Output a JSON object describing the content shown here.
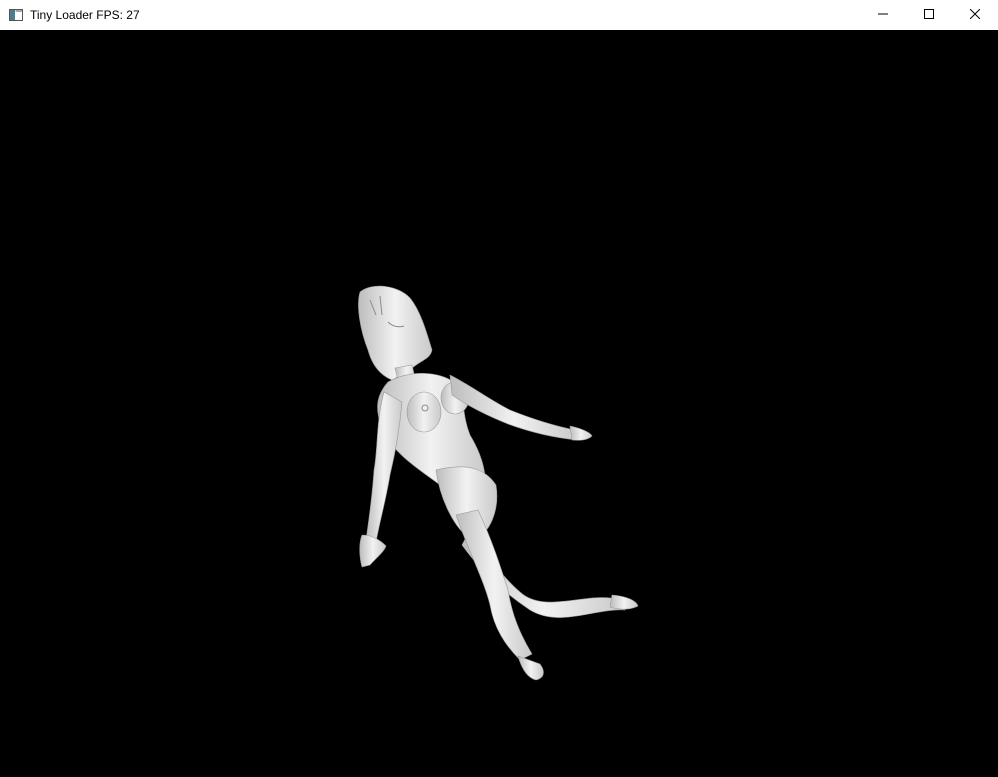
{
  "window": {
    "title": "Tiny Loader FPS: 27",
    "icon": "app-window-icon",
    "controls": {
      "minimize_icon": "minimize-icon",
      "maximize_icon": "maximize-icon",
      "close_icon": "close-icon"
    }
  },
  "viewport": {
    "background": "#000000",
    "model_color": "#e8e8e8",
    "content": "rendered-3d-figure"
  }
}
